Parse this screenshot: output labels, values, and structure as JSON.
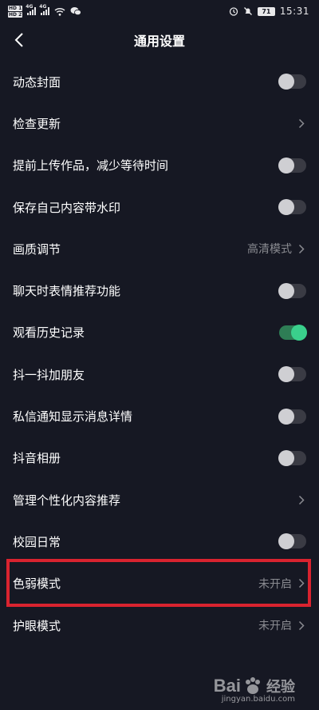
{
  "status_bar": {
    "hd_badges": [
      "HD 1",
      "HD 2"
    ],
    "signal_tags": [
      "4G",
      "4G"
    ],
    "battery": "71",
    "time": "15:31"
  },
  "nav": {
    "title": "通用设置"
  },
  "settings": [
    {
      "label": "动态封面",
      "control": "toggle",
      "on": false
    },
    {
      "label": "检查更新",
      "control": "arrow",
      "value": ""
    },
    {
      "label": "提前上传作品，减少等待时间",
      "control": "toggle",
      "on": false
    },
    {
      "label": "保存自己内容带水印",
      "control": "toggle",
      "on": false
    },
    {
      "label": "画质调节",
      "control": "arrow",
      "value": "高清模式"
    },
    {
      "label": "聊天时表情推荐功能",
      "control": "toggle",
      "on": false
    },
    {
      "label": "观看历史记录",
      "control": "toggle",
      "on": true
    },
    {
      "label": "抖一抖加朋友",
      "control": "toggle",
      "on": false
    },
    {
      "label": "私信通知显示消息详情",
      "control": "toggle",
      "on": false
    },
    {
      "label": "抖音相册",
      "control": "toggle",
      "on": false
    },
    {
      "label": "管理个性化内容推荐",
      "control": "arrow",
      "value": ""
    },
    {
      "label": "校园日常",
      "control": "toggle",
      "on": false
    },
    {
      "label": "色弱模式",
      "control": "arrow",
      "value": "未开启"
    },
    {
      "label": "护眼模式",
      "control": "arrow",
      "value": "未开启"
    }
  ],
  "colors": {
    "background": "#161823",
    "toggle_on": "#3ad08c",
    "highlight": "#d9232f"
  },
  "watermark": {
    "brand_latin": "Bai",
    "brand_cn": "经验",
    "url": "jingyan.baidu.com"
  }
}
